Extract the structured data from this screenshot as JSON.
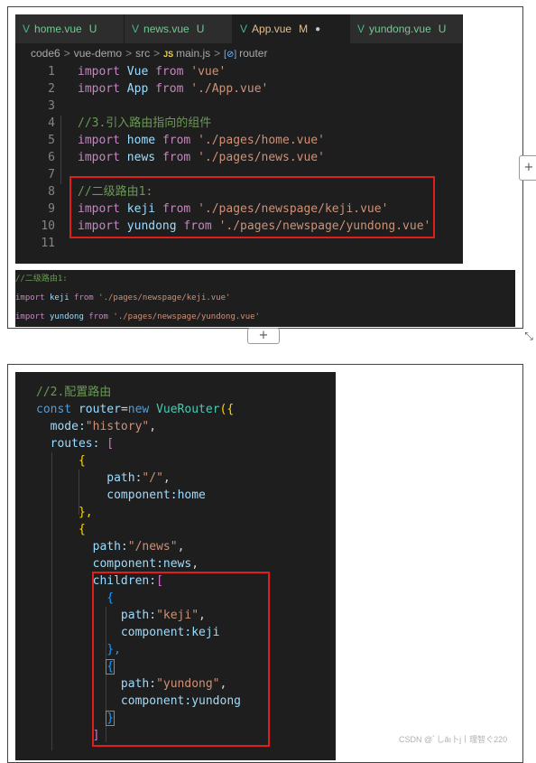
{
  "editor": {
    "tabs": [
      {
        "name": "home.vue",
        "status": "U"
      },
      {
        "name": "news.vue",
        "status": "U"
      },
      {
        "name": "App.vue",
        "status": "M"
      },
      {
        "name": "yundong.vue",
        "status": "U"
      }
    ],
    "vue_glyph": "V",
    "dirty_dot": "●",
    "breadcrumb": {
      "parts": [
        "code6",
        "vue-demo",
        "src"
      ],
      "sep": ">",
      "js_badge": "JS",
      "file": "main.js",
      "symbol_badge": "[⊘]",
      "symbol": "router"
    },
    "line_numbers": [
      "1",
      "2",
      "3",
      "4",
      "5",
      "6",
      "7",
      "8",
      "9",
      "10",
      "11"
    ],
    "lines": {
      "l1": {
        "kw": "import",
        "id": "Vue",
        "from": "from",
        "str": "'vue'"
      },
      "l2": {
        "kw": "import",
        "id": "App",
        "from": "from",
        "str": "'./App.vue'"
      },
      "l4": {
        "comment": "//3.引入路由指向的组件"
      },
      "l5": {
        "kw": "import",
        "id": "home",
        "from": "from",
        "str": "'./pages/home.vue'"
      },
      "l6": {
        "kw": "import",
        "id": "news",
        "from": "from",
        "str": "'./pages/news.vue'"
      },
      "l8": {
        "comment": "//二级路由1:"
      },
      "l9": {
        "kw": "import",
        "id": "keji",
        "from": "from",
        "str": "'./pages/newspage/keji.vue'"
      },
      "l10": {
        "kw": "import",
        "id": "yundong",
        "from": "from",
        "str": "'./pages/newspage/yundong.vue'"
      }
    }
  },
  "snippet": {
    "comment": "//二级路由1:",
    "line1": {
      "kw": "import",
      "id": "keji",
      "from": "from",
      "str": "'./pages/newspage/keji.vue'"
    },
    "line2": {
      "kw": "import",
      "id": "yundong",
      "from": "from",
      "str": "'./pages/newspage/yundong.vue'"
    }
  },
  "controls": {
    "plus": "+",
    "resize": "⤡"
  },
  "router_code": {
    "comment": "//2.配置路由",
    "const_kw": "const",
    "var": "router",
    "eq": "=",
    "new_kw": "new",
    "cls": "VueRouter",
    "open": "({",
    "mode_key": "mode:",
    "mode_val": "\"history\"",
    "routes_key": "routes:",
    "bracket_open": "[",
    "brace_open": "{",
    "path_key": "path:",
    "path_root": "\"/\"",
    "component_key": "component:",
    "home": "home",
    "brace_close_comma": "},",
    "path_news": "\"/news\"",
    "news": "news",
    "children_key": "children:",
    "path_keji": "\"keji\"",
    "keji": "keji",
    "path_yundong": "\"yundong\"",
    "yundong": "yundong",
    "brace_close": "}",
    "bracket_close": "]",
    "comma": ","
  },
  "watermark": "CSDN @ﾞしăı卜j丨理智ぐ220"
}
